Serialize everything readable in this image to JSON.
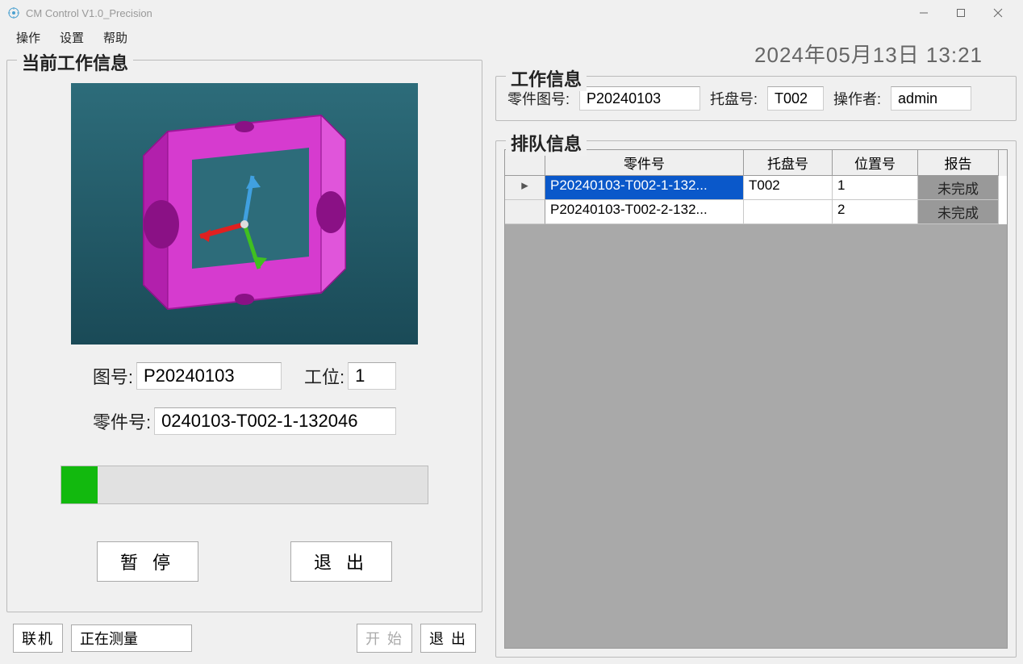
{
  "window": {
    "title": "CM Control V1.0_Precision"
  },
  "menu": {
    "operate": "操作",
    "settings": "设置",
    "help": "帮助"
  },
  "datetime": "2024年05月13日 13:21",
  "current_work": {
    "title": "当前工作信息",
    "drawing_label": "图号:",
    "drawing_value": "P20240103",
    "station_label": "工位:",
    "station_value": "1",
    "part_label": "零件号:",
    "part_value": "0240103-T002-1-132046",
    "progress_percent": 10,
    "pause_btn": "暂 停",
    "exit_btn": "退 出"
  },
  "bottom": {
    "connect_btn": "联机",
    "status": "正在测量",
    "start_btn": "开 始",
    "exit_btn": "退 出"
  },
  "work_info": {
    "title": "工作信息",
    "drawing_label": "零件图号:",
    "drawing_value": "P20240103",
    "tray_label": "托盘号:",
    "tray_value": "T002",
    "operator_label": "操作者:",
    "operator_value": "admin"
  },
  "queue": {
    "title": "排队信息",
    "headers": {
      "part": "零件号",
      "tray": "托盘号",
      "pos": "位置号",
      "report": "报告"
    },
    "rows": [
      {
        "indicator": "▸",
        "part": "P20240103-T002-1-132...",
        "tray": "T002",
        "pos": "1",
        "report": "未完成",
        "selected": true
      },
      {
        "indicator": "",
        "part": "P20240103-T002-2-132...",
        "tray": "",
        "pos": "2",
        "report": "未完成",
        "selected": false
      }
    ]
  }
}
